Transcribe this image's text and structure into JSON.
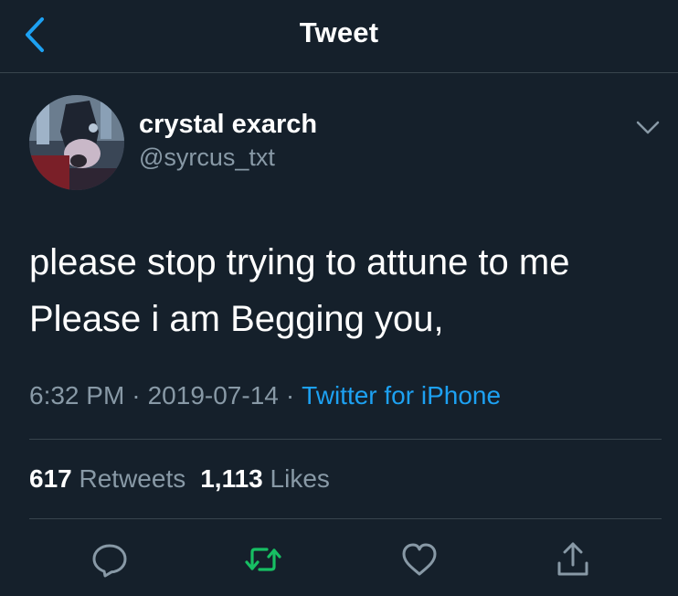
{
  "header": {
    "title": "Tweet",
    "back_icon": "chevron-left-icon"
  },
  "author": {
    "display_name": "crystal exarch",
    "handle": "@syrcus_txt"
  },
  "tweet": {
    "lines": [
      "please stop trying to attune to me",
      "Please i am Begging you,"
    ],
    "time": "6:32 PM",
    "date": "2019-07-14",
    "source": "Twitter for iPhone"
  },
  "stats": {
    "retweets_count": "617",
    "retweets_label": "Retweets",
    "likes_count": "1,113",
    "likes_label": "Likes"
  },
  "actions": [
    {
      "icon": "reply-icon"
    },
    {
      "icon": "retweet-icon"
    },
    {
      "icon": "like-icon"
    },
    {
      "icon": "share-icon"
    }
  ],
  "colors": {
    "background": "#15202b",
    "accent": "#1da1f2",
    "retweet_active": "#17bf63",
    "secondary_text": "#8899a6",
    "divider": "#38444d"
  }
}
